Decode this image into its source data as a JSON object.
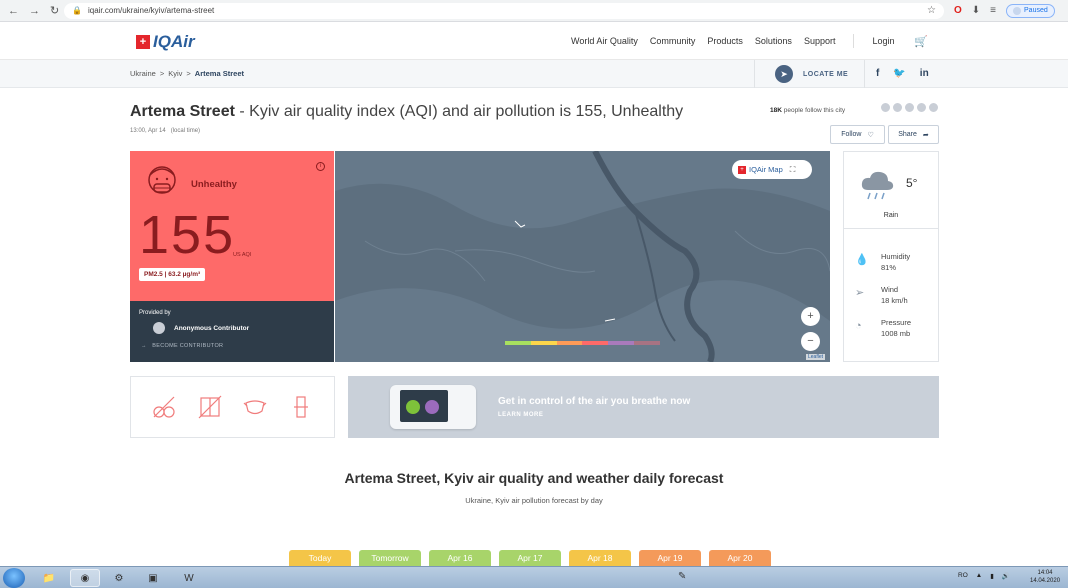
{
  "browser": {
    "url": "iqair.com/ukraine/kyiv/artema-street",
    "paused_label": "Paused"
  },
  "header": {
    "logo_text": "IQAir",
    "nav": [
      "World Air Quality",
      "Community",
      "Products",
      "Solutions",
      "Support"
    ],
    "login": "Login"
  },
  "breadcrumb": {
    "items": [
      "Ukraine",
      "Kyiv",
      "Artema Street"
    ],
    "separator": ">",
    "locate_label": "LOCATE ME"
  },
  "page": {
    "title_bold": "Artema Street",
    "title_rest": " - Kyiv air quality index (AQI) and air pollution is 155, Unhealthy",
    "time": "13:00, Apr 14",
    "time_note": "(local time)",
    "followers_count": "18K",
    "followers_text": " people follow this city",
    "follow_label": "Follow",
    "share_label": "Share"
  },
  "aqi": {
    "status": "Unhealthy",
    "value": "155",
    "unit": "US AQI",
    "pollutant": "PM2.5 | 63.2 µg/m³",
    "color": "#fe6a69",
    "provided_by_label": "Provided by",
    "contributor": "Anonymous Contributor",
    "become_contributor": "BECOME CONTRIBUTOR"
  },
  "map": {
    "badge": "IQAir Map",
    "zoom_in": "+",
    "zoom_out": "−",
    "attribution": "Leaflet",
    "scale_colors": [
      "#a8e05f",
      "#fdd64b",
      "#ff9b57",
      "#fe6a69",
      "#a97abc",
      "#a87383"
    ]
  },
  "weather": {
    "temp": "5°",
    "condition": "Rain",
    "humidity_label": "Humidity",
    "humidity_value": "81%",
    "wind_label": "Wind",
    "wind_value": "18 km/h",
    "pressure_label": "Pressure",
    "pressure_value": "1008 mb"
  },
  "promo": {
    "headline": "Get in control of the air you breathe now",
    "cta": "LEARN MORE"
  },
  "forecast": {
    "title": "Artema Street, Kyiv air quality and weather daily forecast",
    "subtitle": "Ukraine, Kyiv air pollution forecast by day",
    "days": [
      {
        "label": "Today",
        "color": "#f4c548"
      },
      {
        "label": "Tomorrow",
        "color": "#a8d46a"
      },
      {
        "label": "Apr 16",
        "color": "#a8d46a"
      },
      {
        "label": "Apr 17",
        "color": "#a8d46a"
      },
      {
        "label": "Apr 18",
        "color": "#f4c548"
      },
      {
        "label": "Apr 19",
        "color": "#f49a5a"
      },
      {
        "label": "Apr 20",
        "color": "#f49a5a"
      }
    ]
  },
  "taskbar": {
    "lang": "RO",
    "time": "14:04",
    "date": "14.04.2020"
  }
}
